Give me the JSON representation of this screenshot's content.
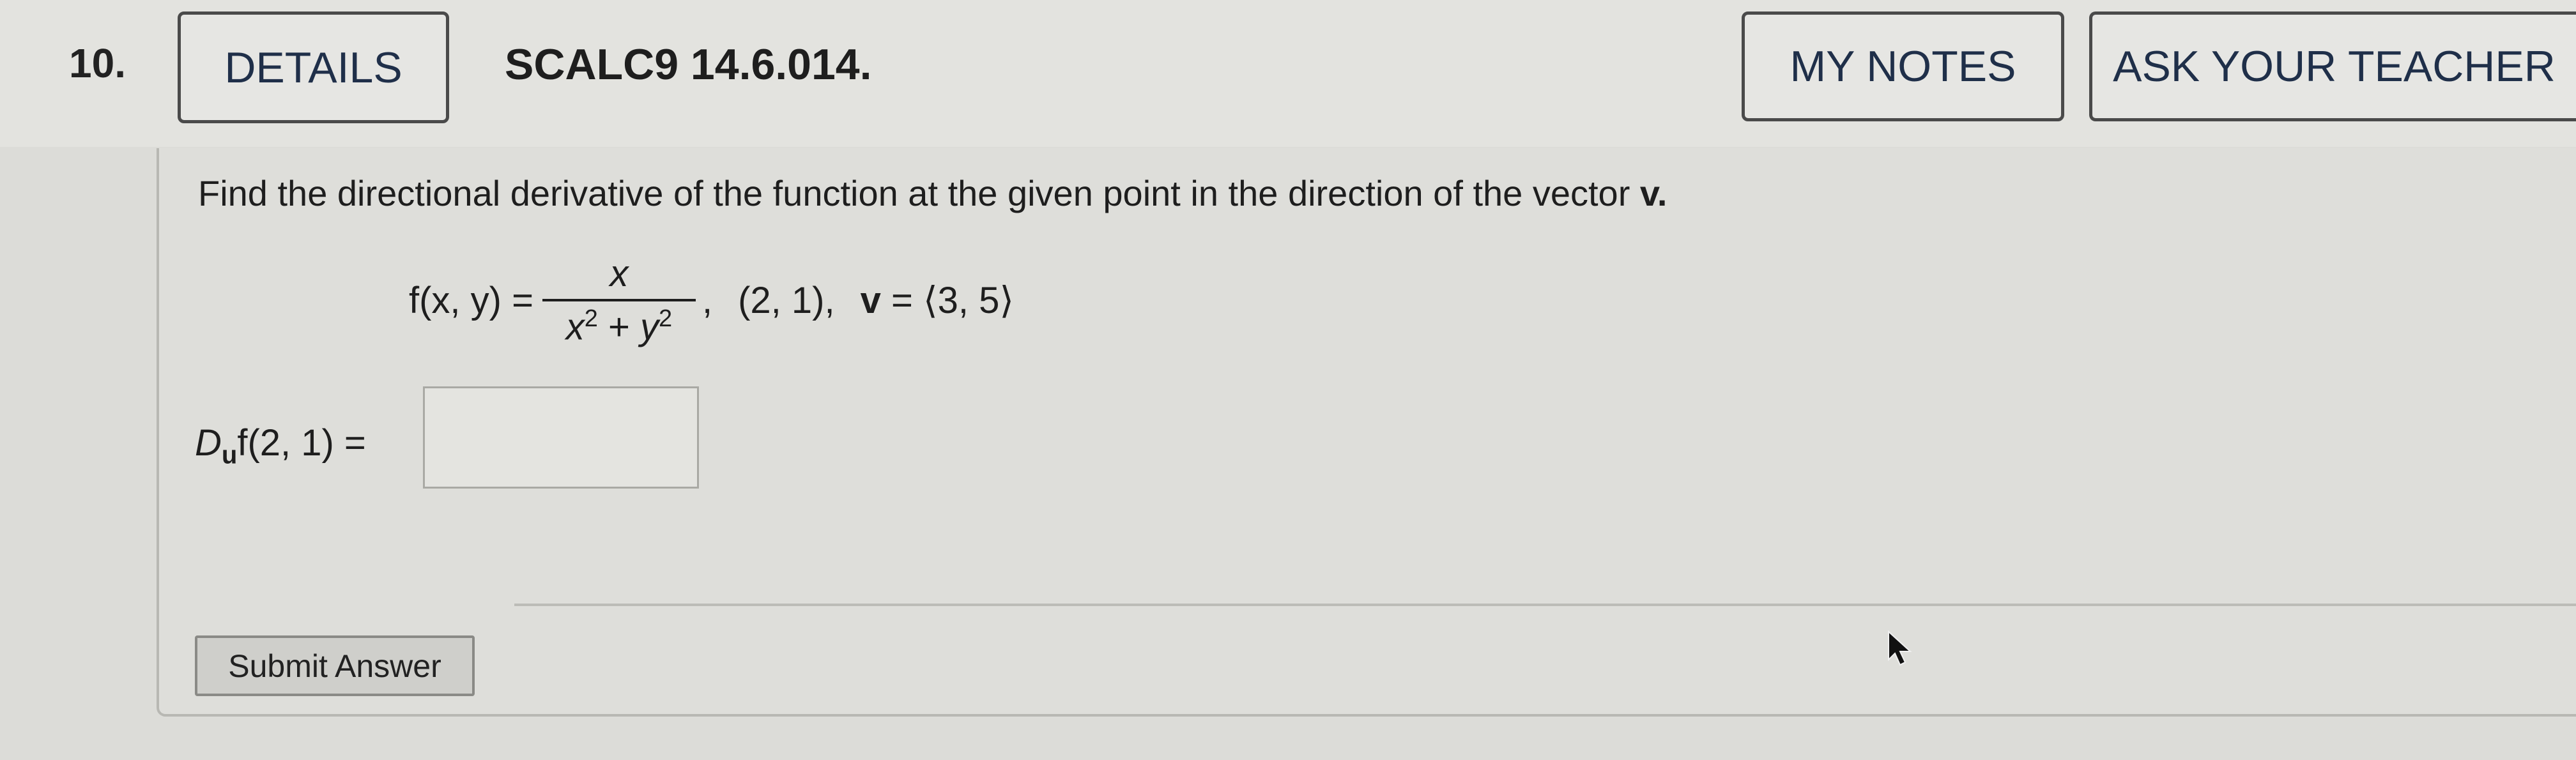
{
  "question": {
    "number": "10.",
    "details_label": "DETAILS",
    "code": "SCALC9 14.6.014.",
    "my_notes_label": "MY NOTES",
    "ask_teacher_label": "ASK YOUR TEACHER"
  },
  "problem": {
    "prompt": "Find the directional derivative of the function at the given point in the direction of the vector",
    "prompt_vector": "v.",
    "function_lhs": "f(x, y) =",
    "numerator": "x",
    "denominator_x": "x",
    "exp1": "2",
    "plus": " + ",
    "denominator_y": "y",
    "exp2": "2",
    "fraction_comma": ",",
    "point": "(2, 1),",
    "vector_name": "v",
    "vector_value": "= ⟨3, 5⟩"
  },
  "answer": {
    "label_d": "D",
    "label_sub": "u",
    "label_rest": "f(2, 1) =",
    "input_value": "",
    "submit_label": "Submit Answer"
  }
}
